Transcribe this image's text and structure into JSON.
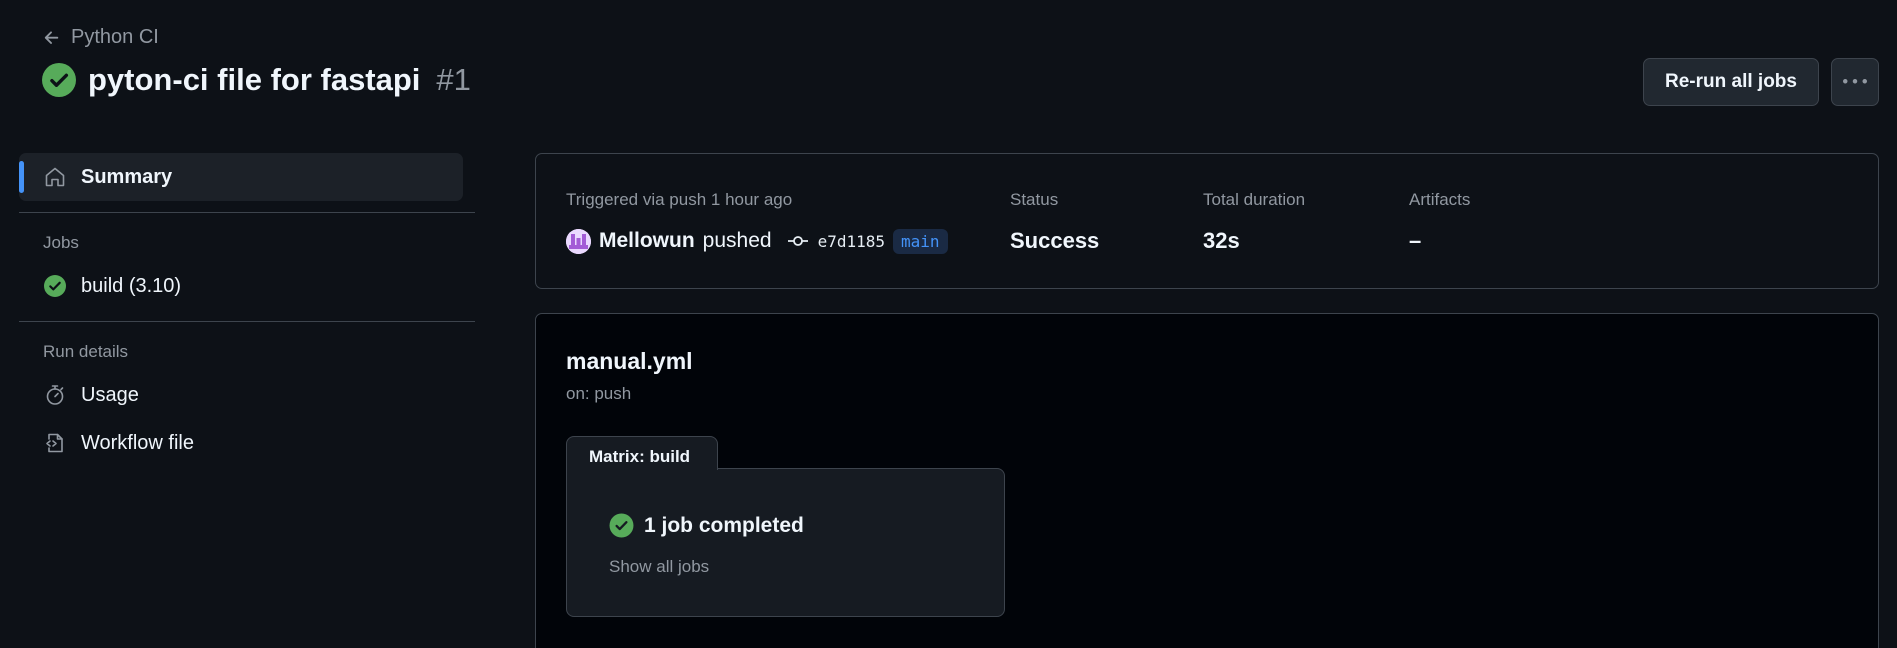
{
  "header": {
    "back_label": "Python CI",
    "run_title": "pyton-ci file for fastapi",
    "run_number": "#1",
    "rerun_label": "Re-run all jobs"
  },
  "sidebar": {
    "summary_label": "Summary",
    "jobs_section": "Jobs",
    "jobs": [
      {
        "label": "build (3.10)",
        "status": "success"
      }
    ],
    "run_details_section": "Run details",
    "usage_label": "Usage",
    "workflow_file_label": "Workflow file"
  },
  "summary": {
    "trigger_text": "Triggered via push 1 hour ago",
    "actor": "Mellowun",
    "action": "pushed",
    "commit_sha": "e7d1185",
    "branch": "main",
    "status_label": "Status",
    "status_value": "Success",
    "duration_label": "Total duration",
    "duration_value": "32s",
    "artifacts_label": "Artifacts",
    "artifacts_value": "–"
  },
  "workflow": {
    "file_name": "manual.yml",
    "trigger": "on: push",
    "matrix_label": "Matrix: build",
    "jobs_completed": "1 job completed",
    "show_all_label": "Show all jobs"
  },
  "colors": {
    "background": "#0d1117",
    "success": "#57ab5a",
    "accent": "#4493f8",
    "muted_text": "#9198a1",
    "border": "#3d444d"
  },
  "icons": [
    "arrow-left-icon",
    "check-circle-icon",
    "kebab-horizontal-icon",
    "home-icon",
    "stopwatch-icon",
    "file-code-icon",
    "git-commit-icon"
  ]
}
